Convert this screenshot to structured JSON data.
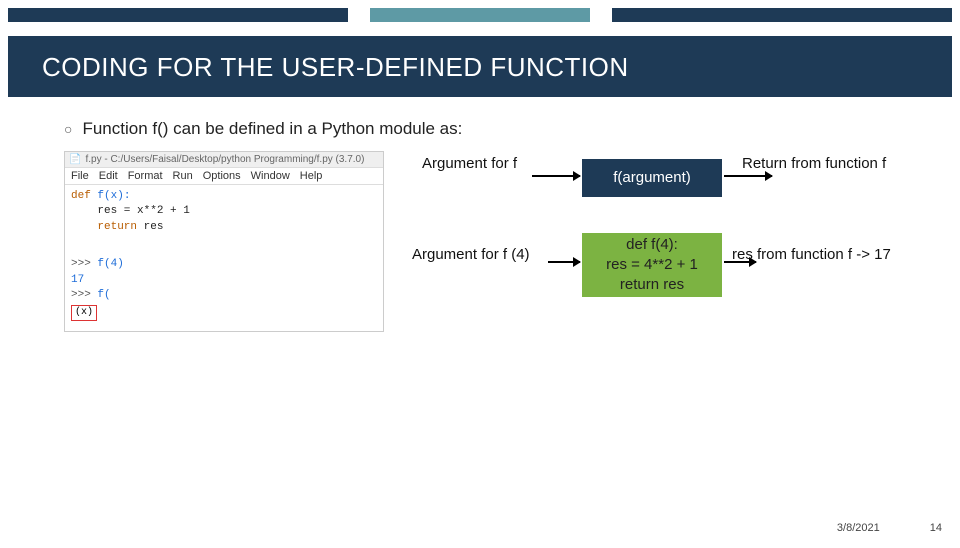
{
  "title": "CODING FOR THE USER-DEFINED FUNCTION",
  "bullet": "Function f() can be defined in a Python module as:",
  "ide": {
    "titlebar": "f.py - C:/Users/Faisal/Desktop/python Programming/f.py (3.7.0)",
    "menu": [
      "File",
      "Edit",
      "Format",
      "Run",
      "Options",
      "Window",
      "Help"
    ],
    "code": {
      "l1a": "def",
      "l1b": " f(x):",
      "l2": "    res = x**2 + 1",
      "l3a": "    return",
      "l3b": " res",
      "p1": ">>>",
      "p1b": " f(4)",
      "o1": "17",
      "p2": ">>>",
      "p2b": " f(",
      "xbox": "(x)"
    }
  },
  "labels": {
    "arg1": "Argument for f",
    "arg2": "Argument for f (4)",
    "ret1": "Return from function f",
    "ret2": "res from function f -> 17"
  },
  "boxes": {
    "b1": "f(argument)",
    "b2l1": "def f(4):",
    "b2l2": "res = 4**2 + 1",
    "b2l3": "return res"
  },
  "footer": {
    "date": "3/8/2021",
    "page": "14"
  }
}
